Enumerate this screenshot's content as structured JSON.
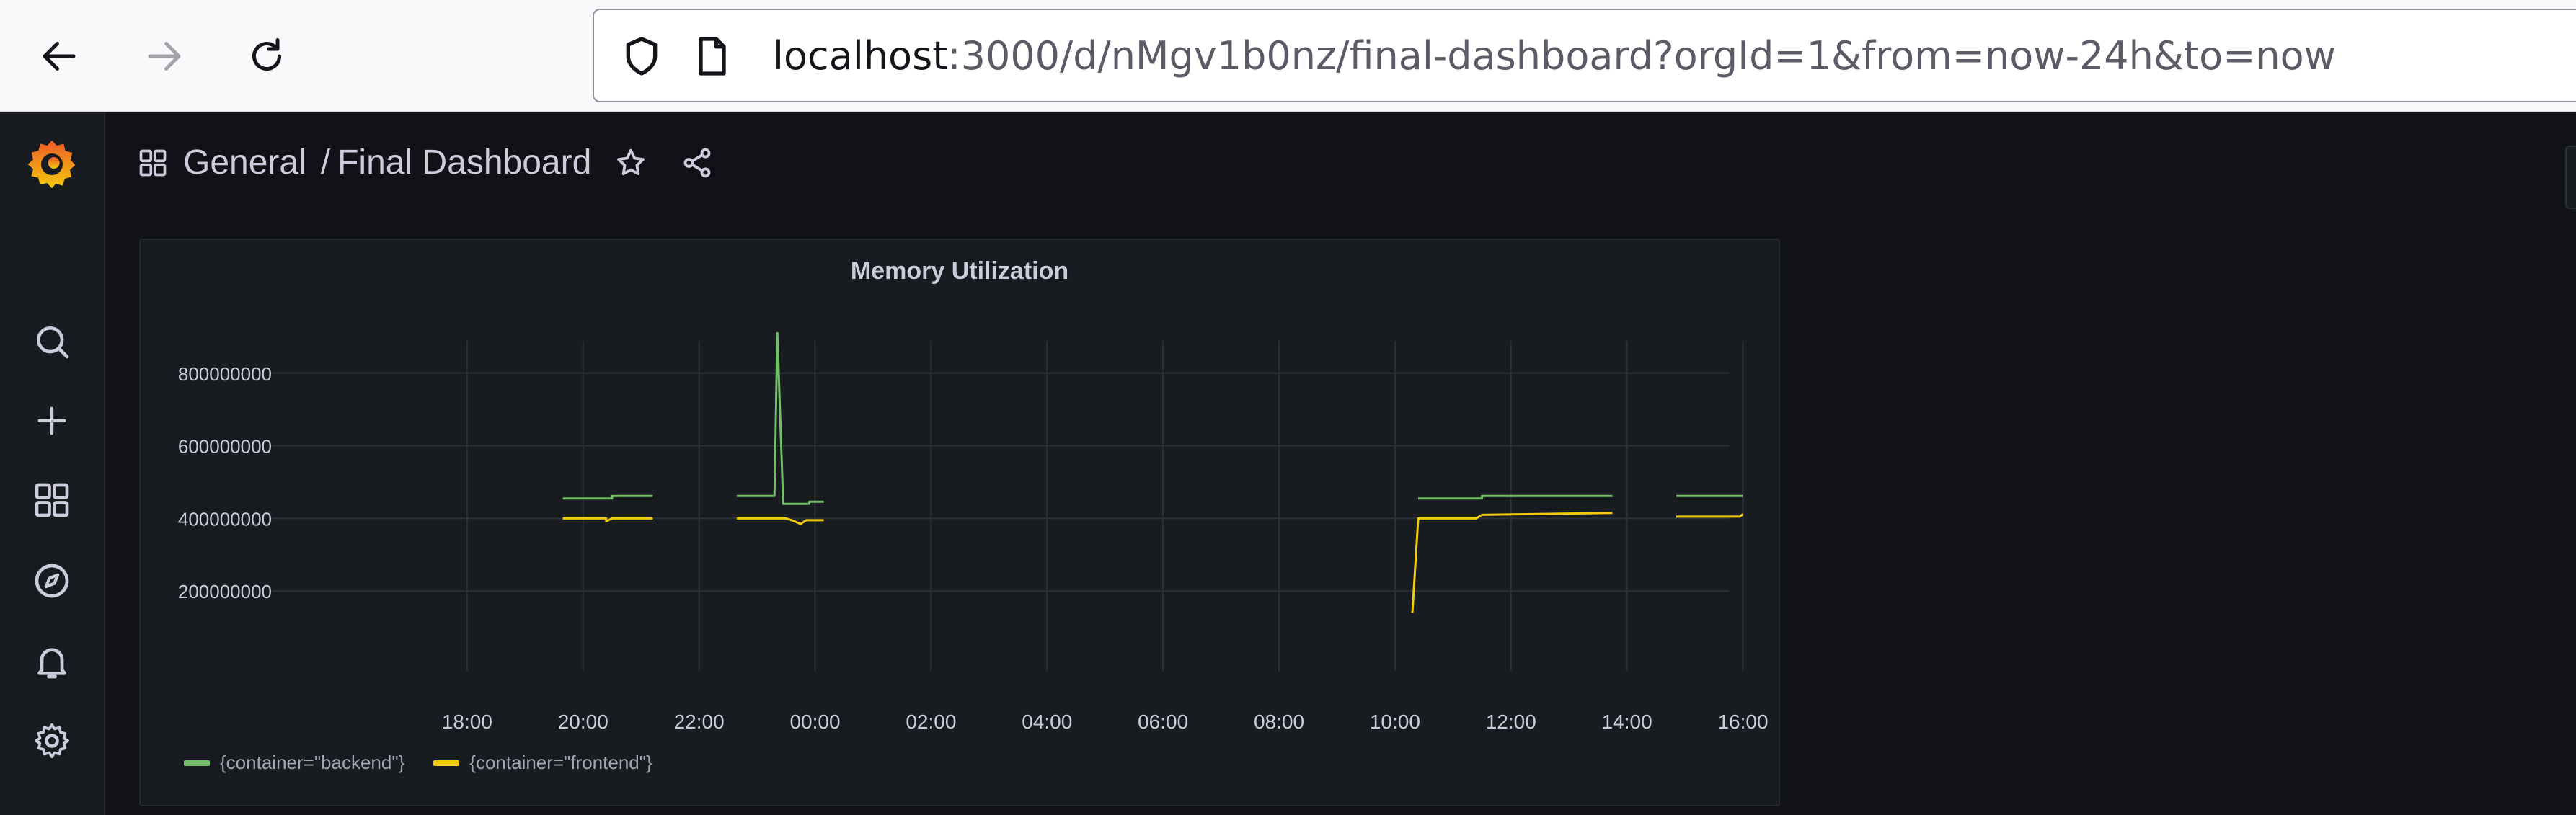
{
  "browser": {
    "url_host": "localhost",
    "url_rest": ":3000/d/nMgv1b0nz/final-dashboard?orgId=1&from=now-24h&to=now"
  },
  "sidebar": {
    "items": [
      {
        "name": "grafana-logo-icon"
      },
      {
        "name": "search-icon"
      },
      {
        "name": "plus-icon"
      },
      {
        "name": "dashboards-icon"
      },
      {
        "name": "compass-icon"
      },
      {
        "name": "bell-icon"
      },
      {
        "name": "gear-icon"
      }
    ]
  },
  "breadcrumb": {
    "folder": "General",
    "separator": "/",
    "title": "Final Dashboard"
  },
  "colors": {
    "backend": "#73bf69",
    "frontend": "#f2cc0c",
    "grid": "#2c3039"
  },
  "panel": {
    "title": "Memory Utilization"
  },
  "chart_data": {
    "type": "line",
    "title": "Memory Utilization",
    "xlabel": "",
    "ylabel": "",
    "x_ticks": [
      "18:00",
      "20:00",
      "22:00",
      "00:00",
      "02:00",
      "04:00",
      "06:00",
      "08:00",
      "10:00",
      "12:00",
      "14:00",
      "16:00"
    ],
    "y_ticks": [
      "200000000",
      "400000000",
      "600000000",
      "800000000"
    ],
    "xlim_hours": [
      16.0,
      39.0
    ],
    "ylim": [
      0,
      1000000000
    ],
    "grid": true,
    "legend_position": "bottom-left",
    "series": [
      {
        "name": "{container=\"backend\"}",
        "color": "#73bf69",
        "segments": [
          [
            [
              19.65,
              455000000
            ],
            [
              20.5,
              455000000
            ],
            [
              20.5,
              462000000
            ],
            [
              21.2,
              462000000
            ]
          ],
          [
            [
              22.65,
              462000000
            ],
            [
              23.3,
              462000000
            ],
            [
              23.35,
              910000000
            ],
            [
              23.45,
              440000000
            ],
            [
              23.9,
              440000000
            ],
            [
              23.9,
              446000000
            ],
            [
              24.15,
              446000000
            ]
          ],
          [
            [
              34.4,
              455000000
            ],
            [
              35.5,
              455000000
            ],
            [
              35.5,
              462000000
            ],
            [
              37.75,
              462000000
            ]
          ],
          [
            [
              38.85,
              462000000
            ],
            [
              40.0,
              462000000
            ]
          ]
        ]
      },
      {
        "name": "{container=\"frontend\"}",
        "color": "#f2cc0c",
        "segments": [
          [
            [
              19.65,
              400000000
            ],
            [
              20.4,
              400000000
            ],
            [
              20.4,
              392000000
            ],
            [
              20.5,
              400000000
            ],
            [
              21.2,
              400000000
            ]
          ],
          [
            [
              22.65,
              400000000
            ],
            [
              23.5,
              400000000
            ],
            [
              23.6,
              395000000
            ],
            [
              23.75,
              385000000
            ],
            [
              23.85,
              395000000
            ],
            [
              24.15,
              395000000
            ]
          ],
          [
            [
              34.3,
              140000000
            ],
            [
              34.4,
              400000000
            ],
            [
              35.4,
              400000000
            ],
            [
              35.5,
              410000000
            ],
            [
              37.75,
              415000000
            ]
          ],
          [
            [
              38.85,
              405000000
            ],
            [
              39.95,
              405000000
            ],
            [
              40.0,
              412000000
            ]
          ]
        ]
      }
    ]
  }
}
